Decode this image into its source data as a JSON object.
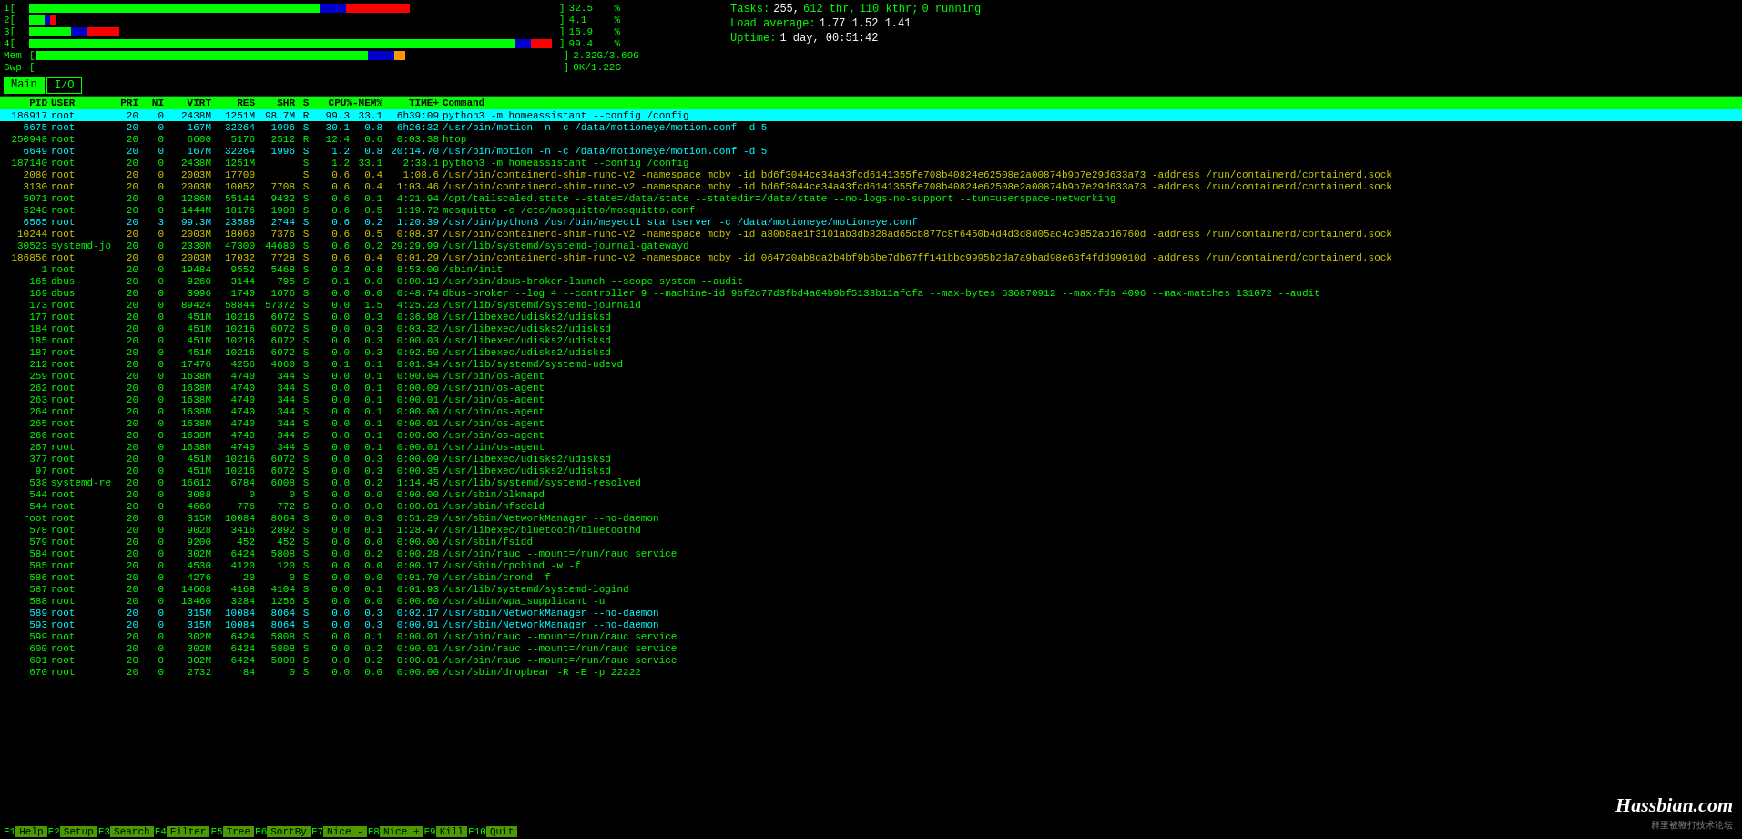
{
  "meters": {
    "cpus": [
      {
        "label": "1",
        "pct": "32.5",
        "green_w": 55,
        "blue_w": 10,
        "red_w": 15,
        "total_w": 620
      },
      {
        "label": "2",
        "pct": "4.1",
        "green_w": 8,
        "blue_w": 2,
        "red_w": 2,
        "total_w": 620
      },
      {
        "label": "3",
        "pct": "15.9",
        "green_w": 20,
        "blue_w": 5,
        "red_w": 8,
        "total_w": 620
      },
      {
        "label": "4",
        "pct": "99.4",
        "green_w": 600,
        "blue_w": 10,
        "red_w": 5,
        "total_w": 620
      }
    ],
    "mem": {
      "label": "Mem",
      "used": "2.32G",
      "total": "3.69G",
      "green_w": 390
    },
    "swp": {
      "label": "Swp",
      "used": "0K",
      "total": "1.22G",
      "green_w": 2
    }
  },
  "stats": {
    "tasks_label": "Tasks:",
    "tasks_val": "255,",
    "thr_val": "612 thr,",
    "kthr_val": "110 kthr;",
    "running_val": "0 running",
    "load_label": "Load average:",
    "load_val": "1.77 1.52 1.41",
    "uptime_label": "Uptime:",
    "uptime_val": "1 day, 00:51:42"
  },
  "tabs": [
    {
      "label": "Main",
      "active": true
    },
    {
      "label": "I/O",
      "active": false
    }
  ],
  "table": {
    "headers": [
      "PID",
      "USER",
      "PRI",
      "NI",
      "VIRT",
      "RES",
      "SHR",
      "S",
      "CPU%-MEM%",
      "TIME+",
      "Command"
    ],
    "rows": [
      {
        "pid": "186917",
        "user": "root",
        "pri": "20",
        "ni": "0",
        "virt": "2438M",
        "res": "1251M",
        "shr": "98.7M",
        "s": "R",
        "cpu": "99.3",
        "mem": "33.1",
        "time": "6h39:09",
        "cmd": "python3 -m homeassistant --config /config",
        "style": "highlight"
      },
      {
        "pid": "6675",
        "user": "root",
        "pri": "20",
        "ni": "0",
        "virt": "167M",
        "res": "32264",
        "shr": "1996",
        "s": "S",
        "cpu": "30.1",
        "mem": "0.8",
        "time": "6h26:32",
        "cmd": "/usr/bin/motion -n -c /data/motioneye/motion.conf -d 5",
        "style": "cyan"
      },
      {
        "pid": "250948",
        "user": "root",
        "pri": "20",
        "ni": "0",
        "virt": "6600",
        "res": "5176",
        "shr": "2512",
        "s": "R",
        "cpu": "12.4",
        "mem": "0.6",
        "time": "0:03.38",
        "cmd": "htop",
        "style": "default"
      },
      {
        "pid": "6649",
        "user": "root",
        "pri": "20",
        "ni": "0",
        "virt": "167M",
        "res": "32264",
        "shr": "1996",
        "s": "S",
        "cpu": "1.2",
        "mem": "0.8",
        "time": "20:14.70",
        "cmd": "/usr/bin/motion -n -c /data/motioneye/motion.conf -d 5",
        "style": "cyan"
      },
      {
        "pid": "187140",
        "user": "root",
        "pri": "20",
        "ni": "0",
        "virt": "2438M",
        "res": "1251M",
        "shr": "",
        "s": "S",
        "cpu": "1.2",
        "mem": "33.1",
        "time": "2:33.1",
        "cmd": "python3 -m homeassistant --config /config",
        "style": "default"
      },
      {
        "pid": "2080",
        "user": "root",
        "pri": "20",
        "ni": "0",
        "virt": "2003M",
        "res": "17700",
        "shr": "",
        "s": "S",
        "cpu": "0.6",
        "mem": "0.4",
        "time": "1:08.6",
        "cmd": "/usr/bin/containerd-shim-runc-v2 -namespace moby -id bd6f3044ce34a43fcd6141355fe708b40824e62508e2a00874b9b7e29d633a73 -address /run/containerd/containerd.sock",
        "style": "yellow"
      },
      {
        "pid": "3130",
        "user": "root",
        "pri": "20",
        "ni": "0",
        "virt": "2003M",
        "res": "10052",
        "shr": "7708",
        "s": "S",
        "cpu": "0.6",
        "mem": "0.4",
        "time": "1:03.46",
        "cmd": "/usr/bin/containerd-shim-runc-v2 -namespace moby -id bd6f3044ce34a43fcd6141355fe708b40824e62508e2a00874b9b7e29d633a73 -address /run/containerd/containerd.sock",
        "style": "yellow"
      },
      {
        "pid": "5071",
        "user": "root",
        "pri": "20",
        "ni": "0",
        "virt": "1286M",
        "res": "55144",
        "shr": "9432",
        "s": "S",
        "cpu": "0.6",
        "mem": "0.1",
        "time": "4:21.94",
        "cmd": "/opt/tailscaled.state --state=/data/state --statedir=/data/state --no-logs-no-support --tun=userspace-networking",
        "style": "default"
      },
      {
        "pid": "5248",
        "user": "root",
        "pri": "20",
        "ni": "0",
        "virt": "1444M",
        "res": "18176",
        "shr": "1908",
        "s": "S",
        "cpu": "0.6",
        "mem": "0.5",
        "time": "1:19.72",
        "cmd": "mosquitto -c /etc/mosquitto/mosquitto.conf",
        "style": "default"
      },
      {
        "pid": "6565",
        "user": "root",
        "pri": "20",
        "ni": "3",
        "virt": "99.3M",
        "res": "23588",
        "shr": "2744",
        "s": "S",
        "cpu": "0.6",
        "mem": "0.2",
        "time": "1:20.39",
        "cmd": "/usr/bin/python3 /usr/bin/meyectl startserver -c /data/motioneye/motioneye.conf",
        "style": "cyan"
      },
      {
        "pid": "10244",
        "user": "root",
        "pri": "20",
        "ni": "0",
        "virt": "2003M",
        "res": "18060",
        "shr": "7376",
        "s": "S",
        "cpu": "0.6",
        "mem": "0.5",
        "time": "0:08.37",
        "cmd": "/usr/bin/containerd-shim-runc-v2 -namespace moby -id a80b8ae1f3101ab3db828ad65cb877c8f6450b4d4d3d8d05ac4c9852ab16760d -address /run/containerd/containerd.sock",
        "style": "yellow"
      },
      {
        "pid": "30523",
        "user": "systemd-jo",
        "pri": "20",
        "ni": "0",
        "virt": "2330M",
        "res": "47300",
        "shr": "44680",
        "s": "S",
        "cpu": "0.6",
        "mem": "0.2",
        "time": "29:29.99",
        "cmd": "/usr/lib/systemd/systemd-journal-gatewayd",
        "style": "default"
      },
      {
        "pid": "186856",
        "user": "root",
        "pri": "20",
        "ni": "0",
        "virt": "2003M",
        "res": "17032",
        "shr": "7728",
        "s": "S",
        "cpu": "0.6",
        "mem": "0.4",
        "time": "0:01.29",
        "cmd": "/usr/bin/containerd-shim-runc-v2 -namespace moby -id 064720ab8da2b4bf9b6be7db67ff141bbc9995b2da7a9bad98e63f4fdd99010d -address /run/containerd/containerd.sock",
        "style": "yellow"
      },
      {
        "pid": "1",
        "user": "root",
        "pri": "20",
        "ni": "0",
        "virt": "19484",
        "res": "9552",
        "shr": "5468",
        "s": "S",
        "cpu": "0.2",
        "mem": "0.8",
        "time": "8:53.00",
        "cmd": "/sbin/init",
        "style": "default"
      },
      {
        "pid": "165",
        "user": "dbus",
        "pri": "20",
        "ni": "0",
        "virt": "9260",
        "res": "3144",
        "shr": "795",
        "s": "S",
        "cpu": "0.1",
        "mem": "0.0",
        "time": "0:00.13",
        "cmd": "/usr/bin/dbus-broker-launch --scope system --audit",
        "style": "default"
      },
      {
        "pid": "169",
        "user": "dbus",
        "pri": "20",
        "ni": "0",
        "virt": "3996",
        "res": "1740",
        "shr": "1076",
        "s": "S",
        "cpu": "0.0",
        "mem": "0.0",
        "time": "0:48.74",
        "cmd": "dbus-broker --log 4 --controller 9 --machine-id 9bf2c77d3fbd4a04b9bf5133b11afcfa --max-bytes 536870912 --max-fds 4096 --max-matches 131072 --audit",
        "style": "default"
      },
      {
        "pid": "173",
        "user": "root",
        "pri": "20",
        "ni": "0",
        "virt": "89424",
        "res": "58844",
        "shr": "57372",
        "s": "S",
        "cpu": "0.0",
        "mem": "1.5",
        "time": "4:25.23",
        "cmd": "/usr/lib/systemd/systemd-journald",
        "style": "default"
      },
      {
        "pid": "177",
        "user": "root",
        "pri": "20",
        "ni": "0",
        "virt": "451M",
        "res": "10216",
        "shr": "6072",
        "s": "S",
        "cpu": "0.0",
        "mem": "0.3",
        "time": "0:36.98",
        "cmd": "/usr/libexec/udisks2/udisksd",
        "style": "default"
      },
      {
        "pid": "184",
        "user": "root",
        "pri": "20",
        "ni": "0",
        "virt": "451M",
        "res": "10216",
        "shr": "6072",
        "s": "S",
        "cpu": "0.0",
        "mem": "0.3",
        "time": "0:03.32",
        "cmd": "/usr/libexec/udisks2/udisksd",
        "style": "default"
      },
      {
        "pid": "185",
        "user": "root",
        "pri": "20",
        "ni": "0",
        "virt": "451M",
        "res": "10216",
        "shr": "6072",
        "s": "S",
        "cpu": "0.0",
        "mem": "0.3",
        "time": "0:00.03",
        "cmd": "/usr/libexec/udisks2/udisksd",
        "style": "default"
      },
      {
        "pid": "187",
        "user": "root",
        "pri": "20",
        "ni": "0",
        "virt": "451M",
        "res": "10216",
        "shr": "6072",
        "s": "S",
        "cpu": "0.0",
        "mem": "0.3",
        "time": "0:02.50",
        "cmd": "/usr/libexec/udisks2/udisksd",
        "style": "default"
      },
      {
        "pid": "212",
        "user": "root",
        "pri": "20",
        "ni": "0",
        "virt": "17476",
        "res": "4256",
        "shr": "4060",
        "s": "S",
        "cpu": "0.1",
        "mem": "0.1",
        "time": "0:01.34",
        "cmd": "/usr/lib/systemd/systemd-udevd",
        "style": "default"
      },
      {
        "pid": "259",
        "user": "root",
        "pri": "20",
        "ni": "0",
        "virt": "1638M",
        "res": "4740",
        "shr": "344",
        "s": "S",
        "cpu": "0.0",
        "mem": "0.1",
        "time": "0:00.04",
        "cmd": "/usr/bin/os-agent",
        "style": "default"
      },
      {
        "pid": "262",
        "user": "root",
        "pri": "20",
        "ni": "0",
        "virt": "1638M",
        "res": "4740",
        "shr": "344",
        "s": "S",
        "cpu": "0.0",
        "mem": "0.1",
        "time": "0:00.09",
        "cmd": "/usr/bin/os-agent",
        "style": "default"
      },
      {
        "pid": "263",
        "user": "root",
        "pri": "20",
        "ni": "0",
        "virt": "1638M",
        "res": "4740",
        "shr": "344",
        "s": "S",
        "cpu": "0.0",
        "mem": "0.1",
        "time": "0:00.01",
        "cmd": "/usr/bin/os-agent",
        "style": "default"
      },
      {
        "pid": "264",
        "user": "root",
        "pri": "20",
        "ni": "0",
        "virt": "1638M",
        "res": "4740",
        "shr": "344",
        "s": "S",
        "cpu": "0.0",
        "mem": "0.1",
        "time": "0:00.00",
        "cmd": "/usr/bin/os-agent",
        "style": "default"
      },
      {
        "pid": "265",
        "user": "root",
        "pri": "20",
        "ni": "0",
        "virt": "1638M",
        "res": "4740",
        "shr": "344",
        "s": "S",
        "cpu": "0.0",
        "mem": "0.1",
        "time": "0:00.01",
        "cmd": "/usr/bin/os-agent",
        "style": "default"
      },
      {
        "pid": "266",
        "user": "root",
        "pri": "20",
        "ni": "0",
        "virt": "1638M",
        "res": "4740",
        "shr": "344",
        "s": "S",
        "cpu": "0.0",
        "mem": "0.1",
        "time": "0:00.00",
        "cmd": "/usr/bin/os-agent",
        "style": "default"
      },
      {
        "pid": "267",
        "user": "root",
        "pri": "20",
        "ni": "0",
        "virt": "1638M",
        "res": "4740",
        "shr": "344",
        "s": "S",
        "cpu": "0.0",
        "mem": "0.1",
        "time": "0:00.01",
        "cmd": "/usr/bin/os-agent",
        "style": "default"
      },
      {
        "pid": "377",
        "user": "root",
        "pri": "20",
        "ni": "0",
        "virt": "451M",
        "res": "10216",
        "shr": "6072",
        "s": "S",
        "cpu": "0.0",
        "mem": "0.3",
        "time": "0:00.09",
        "cmd": "/usr/libexec/udisks2/udisksd",
        "style": "default"
      },
      {
        "pid": "97",
        "user": "root",
        "pri": "20",
        "ni": "0",
        "virt": "451M",
        "res": "10216",
        "shr": "6072",
        "s": "S",
        "cpu": "0.0",
        "mem": "0.3",
        "time": "0:00.35",
        "cmd": "/usr/libexec/udisks2/udisksd",
        "style": "default"
      },
      {
        "pid": "538",
        "user": "systemd-re",
        "pri": "20",
        "ni": "0",
        "virt": "16612",
        "res": "6784",
        "shr": "6008",
        "s": "S",
        "cpu": "0.0",
        "mem": "0.2",
        "time": "1:14.45",
        "cmd": "/usr/lib/systemd/systemd-resolved",
        "style": "default"
      },
      {
        "pid": "544",
        "user": "root",
        "pri": "20",
        "ni": "0",
        "virt": "3088",
        "res": "0",
        "shr": "0",
        "s": "S",
        "cpu": "0.0",
        "mem": "0.0",
        "time": "0:00.00",
        "cmd": "/usr/sbin/blkmapd",
        "style": "default"
      },
      {
        "pid": "544",
        "user": "root",
        "pri": "20",
        "ni": "0",
        "virt": "4660",
        "res": "776",
        "shr": "772",
        "s": "S",
        "cpu": "0.0",
        "mem": "0.0",
        "time": "0:00.01",
        "cmd": "/usr/sbin/nfsdcld",
        "style": "default"
      },
      {
        "pid": "root",
        "user": "root",
        "pri": "20",
        "ni": "0",
        "virt": "315M",
        "res": "10084",
        "shr": "8064",
        "s": "S",
        "cpu": "0.0",
        "mem": "0.3",
        "time": "0:51.29",
        "cmd": "/usr/sbin/NetworkManager --no-daemon",
        "style": "default"
      },
      {
        "pid": "578",
        "user": "root",
        "pri": "20",
        "ni": "0",
        "virt": "9028",
        "res": "3416",
        "shr": "2892",
        "s": "S",
        "cpu": "0.0",
        "mem": "0.1",
        "time": "1:28.47",
        "cmd": "/usr/libexec/bluetooth/bluetoothd",
        "style": "default"
      },
      {
        "pid": "579",
        "user": "root",
        "pri": "20",
        "ni": "0",
        "virt": "9200",
        "res": "452",
        "shr": "452",
        "s": "S",
        "cpu": "0.0",
        "mem": "0.0",
        "time": "0:00.00",
        "cmd": "/usr/sbin/fsidd",
        "style": "default"
      },
      {
        "pid": "584",
        "user": "root",
        "pri": "20",
        "ni": "0",
        "virt": "302M",
        "res": "6424",
        "shr": "5808",
        "s": "S",
        "cpu": "0.0",
        "mem": "0.2",
        "time": "0:00.28",
        "cmd": "/usr/bin/rauc --mount=/run/rauc service",
        "style": "default"
      },
      {
        "pid": "585",
        "user": "root",
        "pri": "20",
        "ni": "0",
        "virt": "4530",
        "res": "4120",
        "shr": "120",
        "s": "S",
        "cpu": "0.0",
        "mem": "0.0",
        "time": "0:00.17",
        "cmd": "/usr/sbin/rpcbind -w -f",
        "style": "default"
      },
      {
        "pid": "586",
        "user": "root",
        "pri": "20",
        "ni": "0",
        "virt": "4276",
        "res": "20",
        "shr": "0",
        "s": "S",
        "cpu": "0.0",
        "mem": "0.0",
        "time": "0:01.70",
        "cmd": "/usr/sbin/crond -f",
        "style": "default"
      },
      {
        "pid": "587",
        "user": "root",
        "pri": "20",
        "ni": "0",
        "virt": "14668",
        "res": "4168",
        "shr": "4104",
        "s": "S",
        "cpu": "0.0",
        "mem": "0.1",
        "time": "0:01.93",
        "cmd": "/usr/lib/systemd/systemd-logind",
        "style": "default"
      },
      {
        "pid": "588",
        "user": "root",
        "pri": "20",
        "ni": "0",
        "virt": "13460",
        "res": "3284",
        "shr": "1256",
        "s": "S",
        "cpu": "0.0",
        "mem": "0.0",
        "time": "0:00.60",
        "cmd": "/usr/sbin/wpa_supplicant -u",
        "style": "default"
      },
      {
        "pid": "589",
        "user": "root",
        "pri": "20",
        "ni": "0",
        "virt": "315M",
        "res": "10084",
        "shr": "8064",
        "s": "S",
        "cpu": "0.0",
        "mem": "0.3",
        "time": "0:02.17",
        "cmd": "/usr/sbin/NetworkManager --no-daemon",
        "style": "cyan"
      },
      {
        "pid": "593",
        "user": "root",
        "pri": "20",
        "ni": "0",
        "virt": "315M",
        "res": "10084",
        "shr": "8064",
        "s": "S",
        "cpu": "0.0",
        "mem": "0.3",
        "time": "0:00.91",
        "cmd": "/usr/sbin/NetworkManager --no-daemon",
        "style": "cyan"
      },
      {
        "pid": "599",
        "user": "root",
        "pri": "20",
        "ni": "0",
        "virt": "302M",
        "res": "6424",
        "shr": "5808",
        "s": "S",
        "cpu": "0.0",
        "mem": "0.1",
        "time": "0:00.01",
        "cmd": "/usr/bin/rauc --mount=/run/rauc service",
        "style": "default"
      },
      {
        "pid": "600",
        "user": "root",
        "pri": "20",
        "ni": "0",
        "virt": "302M",
        "res": "6424",
        "shr": "5808",
        "s": "S",
        "cpu": "0.0",
        "mem": "0.2",
        "time": "0:00.01",
        "cmd": "/usr/bin/rauc --mount=/run/rauc service",
        "style": "default"
      },
      {
        "pid": "601",
        "user": "root",
        "pri": "20",
        "ni": "0",
        "virt": "302M",
        "res": "6424",
        "shr": "5808",
        "s": "S",
        "cpu": "0.0",
        "mem": "0.2",
        "time": "0:00.01",
        "cmd": "/usr/bin/rauc --mount=/run/rauc service",
        "style": "default"
      },
      {
        "pid": "670",
        "user": "root",
        "pri": "20",
        "ni": "0",
        "virt": "2732",
        "res": "84",
        "shr": "0",
        "s": "S",
        "cpu": "0.0",
        "mem": "0.0",
        "time": "0:00.00",
        "cmd": "/usr/sbin/dropbear -R -E -p 22222",
        "style": "default"
      }
    ]
  },
  "bottom_keys": [
    {
      "num": "F1",
      "label": "Help"
    },
    {
      "num": "F2",
      "label": "Setup"
    },
    {
      "num": "F3",
      "label": "Search"
    },
    {
      "num": "F4",
      "label": "Filter"
    },
    {
      "num": "F5",
      "label": "Tree"
    },
    {
      "num": "F6",
      "label": "SortBy"
    },
    {
      "num": "F7",
      "label": "Nice -"
    },
    {
      "num": "F8",
      "label": "Nice +"
    },
    {
      "num": "F9",
      "label": "Kill"
    },
    {
      "num": "F10",
      "label": "Quit"
    }
  ],
  "watermark": "Hassbian.com",
  "watermark_sub": "群里被鞭打技术论坛"
}
